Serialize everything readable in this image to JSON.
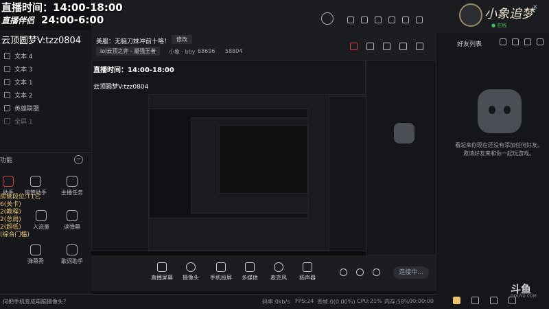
{
  "overlay": {
    "line1": "直播时间：14:00-18:00",
    "brand": "直播伴侣",
    "line2": "24:00-6:00"
  },
  "stream_id": "云顶圆梦V:tzz0804",
  "room": {
    "title": "美服：无脑刀妹冲前十咯！",
    "edit_label": "修改",
    "category": "lol云顶之弈 - 最强王者",
    "owner": "小象 · bby",
    "room_num": "68696",
    "fans": "58804"
  },
  "sources": [
    {
      "label": "文本 4"
    },
    {
      "label": "文本 3"
    },
    {
      "label": "文本 1"
    },
    {
      "label": "文本 2"
    },
    {
      "label": "英雄联盟"
    },
    {
      "label": "全屏 1"
    }
  ],
  "tools": {
    "title": "功能",
    "toggle": "−",
    "items": [
      {
        "label": "助手"
      },
      {
        "label": "房管助手"
      },
      {
        "label": "主播任务"
      },
      {
        "label": "入流量"
      },
      {
        "label": "读弹幕"
      },
      {
        "label": "弹幕秀"
      },
      {
        "label": "歌词助手"
      }
    ],
    "side_text": "房管段位:T1它\n6(关卡)\n2(教程)\n2(总局)\n2(超低)\n(综合门槛)"
  },
  "toolbar": {
    "items": [
      {
        "label": "直播屏幕"
      },
      {
        "label": "摄像头"
      },
      {
        "label": "手机投屏"
      },
      {
        "label": "多媒体"
      },
      {
        "label": "麦克风"
      },
      {
        "label": "扬声器"
      }
    ],
    "live_label": "连接中..."
  },
  "status": {
    "message": "何把手机变成电脑摄像头？",
    "net": "码率:0kb/s",
    "fps": "FPS:24",
    "drop": "丢帧:0(0.00%)",
    "cpu": "CPU:21%",
    "mem": "内存:58%",
    "time": "00:00:00"
  },
  "right": {
    "signature": "小象追梦",
    "online": "● 在线",
    "friends_title": "好友列表",
    "empty_text": "看起来你现在还没有添加任何好友。邀请好友来和你一起玩游戏。",
    "brand": "斗鱼",
    "brand_sub": "DOUYU.COM"
  }
}
